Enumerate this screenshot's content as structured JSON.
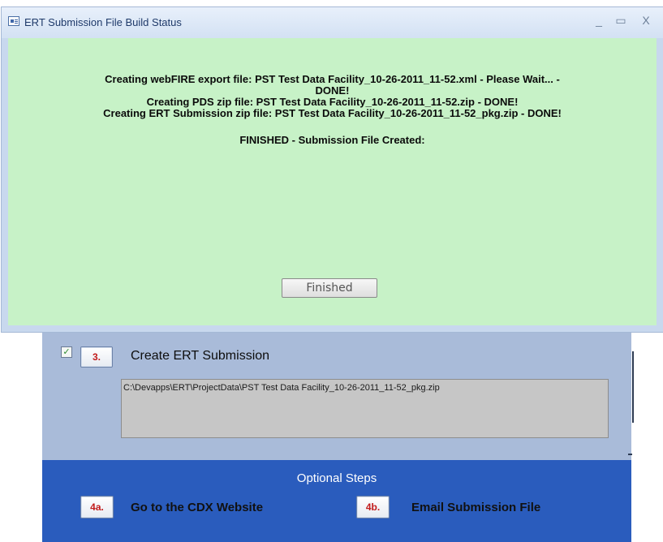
{
  "window": {
    "title": "ERT Submission File Build Status",
    "controls": {
      "minimize": "_",
      "maximize": "▭",
      "close": "X"
    }
  },
  "status": {
    "line1": "Creating webFIRE export file: PST Test Data Facility_10-26-2011_11-52.xml - Please Wait... -",
    "line1b": "DONE!",
    "line2": "Creating PDS zip file: PST Test Data Facility_10-26-2011_11-52.zip - DONE!",
    "line3": "Creating ERT Submission zip file: PST Test Data Facility_10-26-2011_11-52_pkg.zip - DONE!",
    "line4": "FINISHED - Submission File Created:"
  },
  "finished_button": "Finished",
  "step3": {
    "checked": true,
    "check_glyph": "✓",
    "button": "3.",
    "title": "Create ERT Submission",
    "path": "C:\\Devapps\\ERT\\ProjectData\\PST Test Data Facility_10-26-2011_11-52_pkg.zip"
  },
  "optional": {
    "title": "Optional Steps",
    "step4a_button": "4a.",
    "step4a_label": "Go to the CDX Website",
    "step4b_button": "4b.",
    "step4b_label": "Email Submission File"
  },
  "colors": {
    "dialog_bg": "#c7f2c7",
    "form_bg": "#a9bbd9",
    "optional_bg": "#2a5cbd",
    "step_button_text": "#c21a1a"
  }
}
